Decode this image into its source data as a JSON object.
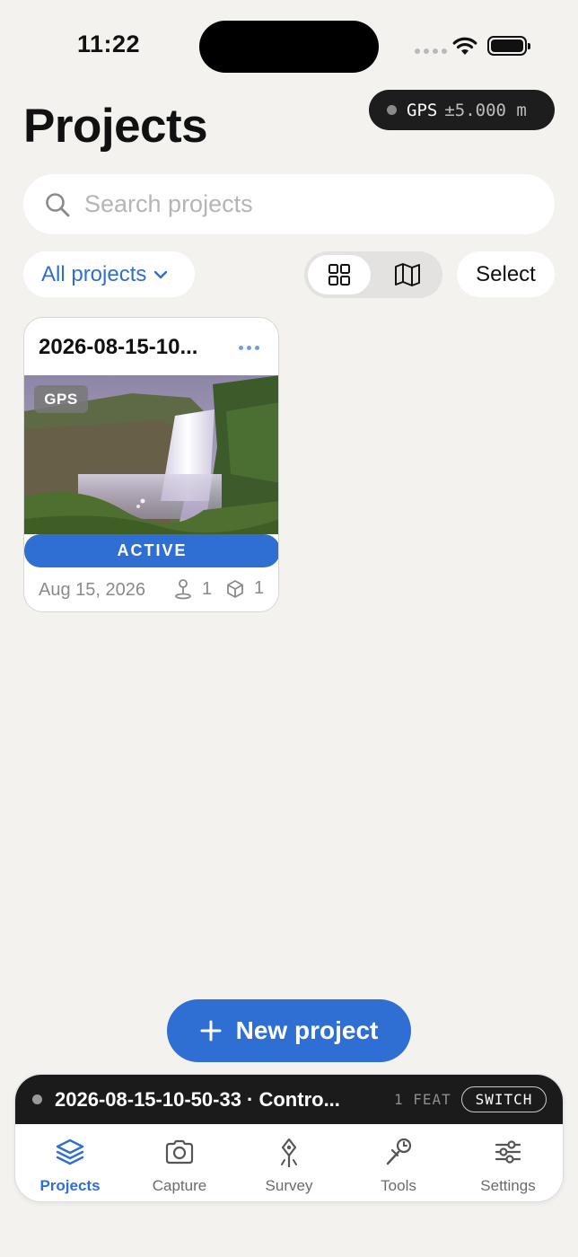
{
  "status_bar": {
    "time": "11:22"
  },
  "gps": {
    "label": "GPS",
    "accuracy": "±5.000 m"
  },
  "page": {
    "title": "Projects"
  },
  "search": {
    "placeholder": "Search projects"
  },
  "filter": {
    "label": "All projects"
  },
  "view_toggle": {
    "selected": "grid"
  },
  "select_label": "Select",
  "projects": [
    {
      "title": "2026-08-15-10...",
      "badge": "GPS",
      "status": "ACTIVE",
      "date": "Aug 15, 2026",
      "points": "1",
      "objects": "1"
    }
  ],
  "new_project_label": "New project",
  "active_project": {
    "name": "2026-08-15-10-50-33 · Contro...",
    "features": "1 FEAT",
    "switch_label": "SWITCH"
  },
  "tabs": [
    {
      "label": "Projects",
      "icon": "layers-icon",
      "active": true
    },
    {
      "label": "Capture",
      "icon": "camera-icon"
    },
    {
      "label": "Survey",
      "icon": "survey-pin-icon"
    },
    {
      "label": "Tools",
      "icon": "tools-icon"
    },
    {
      "label": "Settings",
      "icon": "sliders-icon"
    }
  ],
  "colors": {
    "accent": "#2f6fd3",
    "background": "#f3f2ef",
    "dark": "#1b1b1b"
  }
}
